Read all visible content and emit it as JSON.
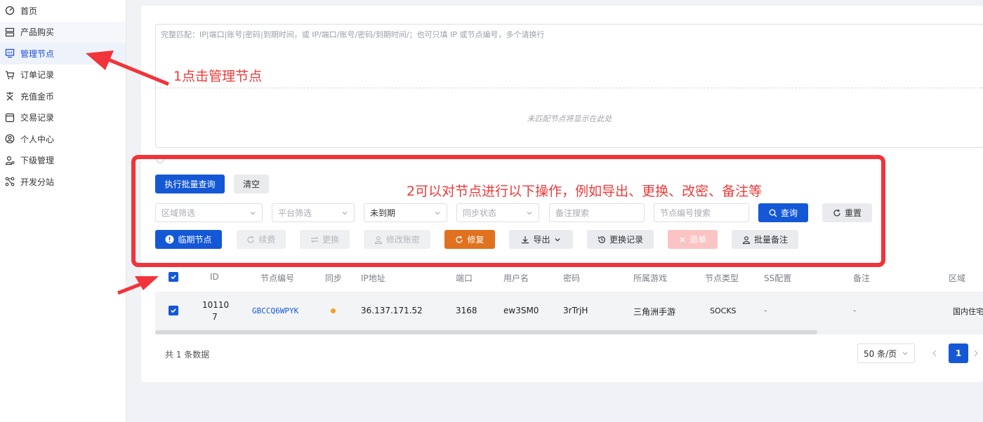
{
  "sidebar": {
    "items": [
      {
        "label": "首页",
        "icon": "dashboard-gauge-icon"
      },
      {
        "label": "产品购买",
        "icon": "server-rack-icon"
      },
      {
        "label": "管理节点",
        "icon": "monitor-icon"
      },
      {
        "label": "订单记录",
        "icon": "shopping-cart-icon"
      },
      {
        "label": "充值金币",
        "icon": "currency-icon"
      },
      {
        "label": "交易记录",
        "icon": "receipt-icon"
      },
      {
        "label": "个人中心",
        "icon": "user-circle-icon"
      },
      {
        "label": "下级管理",
        "icon": "user-settings-icon"
      },
      {
        "label": "开发分站",
        "icon": "network-nodes-icon"
      }
    ],
    "active_index": 2
  },
  "batch": {
    "placeholder": "完整匹配：IP|端口|账号|密码|到期时间，或 IP/端口/账号/密码/到期时间/；也可只填 IP 或节点编号，多个请换行",
    "unmatched_hint": "未匹配节点将显示在此处"
  },
  "toolbar": {
    "run_batch_query": "执行批量查询",
    "clear": "清空",
    "region_filter": "区域筛选",
    "platform_filter": "平台筛选",
    "expiry_select": "未到期",
    "sync_status": "同步状态",
    "remark_search": "备注搜索",
    "node_id_search": "节点编号搜索",
    "query": "查询",
    "reset": "重置",
    "expiring_nodes": "临期节点",
    "renew": "续费",
    "replace": "更换",
    "edit_account": "修改账密",
    "repair": "修复",
    "export": "导出",
    "replace_history": "更换记录",
    "refund": "退单",
    "batch_remark": "批量备注"
  },
  "table": {
    "headers": {
      "id": "ID",
      "node_no": "节点编号",
      "sync": "同步",
      "ip": "IP地址",
      "port": "端口",
      "username": "用户名",
      "password": "密码",
      "game": "所属游戏",
      "node_type": "节点类型",
      "ss_config": "SS配置",
      "remark": "备注",
      "region": "区域"
    },
    "rows": [
      {
        "id_line1": "10110",
        "id_line2": "7",
        "node_no": "GBCCQ6WPYK",
        "ip": "36.137.171.52",
        "port": "3168",
        "username": "ew3SM0",
        "password": "3rTrjH",
        "game": "三角洲手游",
        "node_type": "SOCKS",
        "ss_config": "-",
        "remark": "-",
        "region": "国内住宅"
      }
    ],
    "sync_color": "#f0a020"
  },
  "footer": {
    "total": "共 1 条数据",
    "page_size": "50 条/页",
    "current_page": "1"
  },
  "annotations": {
    "step1": "1点击管理节点",
    "step2": "2可以对节点进行以下操作，例如导出、更换、改密、备注等"
  },
  "colors": {
    "primary": "#1558d6",
    "orange": "#e0721f",
    "annotation": "#f0343a"
  }
}
